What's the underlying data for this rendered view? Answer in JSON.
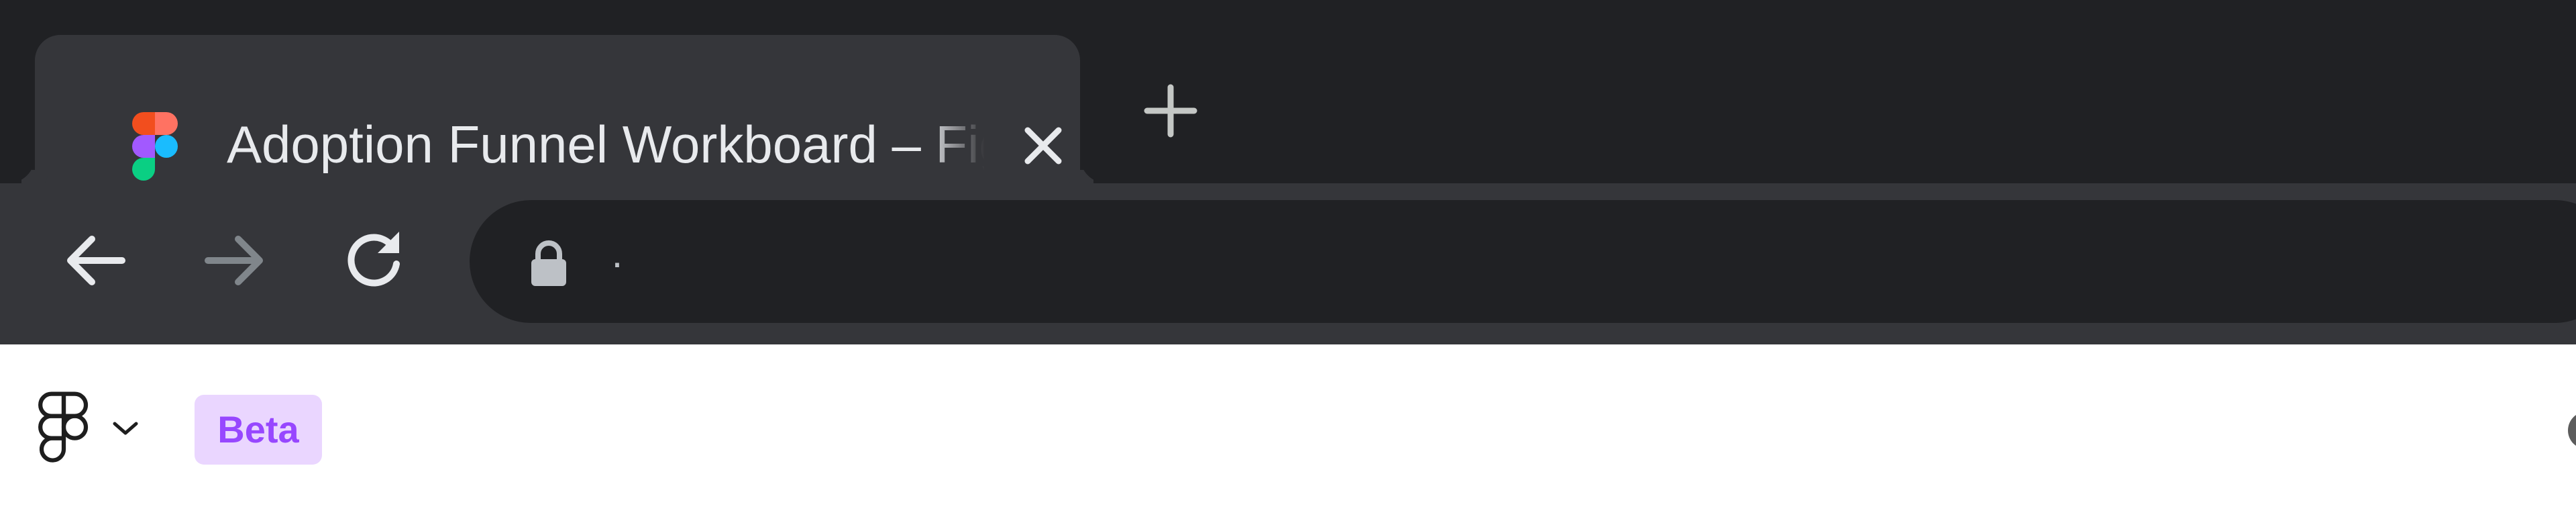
{
  "browser": {
    "tab": {
      "title": "Adoption Funnel Workboard – Figma",
      "favicon_icon": "figma-logo-icon",
      "close_icon": "close-icon"
    },
    "new_tab_icon": "plus-icon",
    "toolbar": {
      "back_icon": "arrow-left-icon",
      "forward_icon": "arrow-right-icon",
      "reload_icon": "reload-icon",
      "lock_icon": "lock-icon",
      "url": "·"
    },
    "colors": {
      "tabstrip_bg": "#202124",
      "active_tab_bg": "#35363a",
      "omnibox_bg": "#202124",
      "text": "#e8eaed",
      "disabled_icon": "#80868b"
    }
  },
  "app": {
    "main_menu_icon": "figma-mark-icon",
    "main_menu_chevron": "chevron-down-icon",
    "badge": "Beta",
    "colors": {
      "badge_bg": "#ead6ff",
      "badge_text": "#9747ff"
    }
  }
}
